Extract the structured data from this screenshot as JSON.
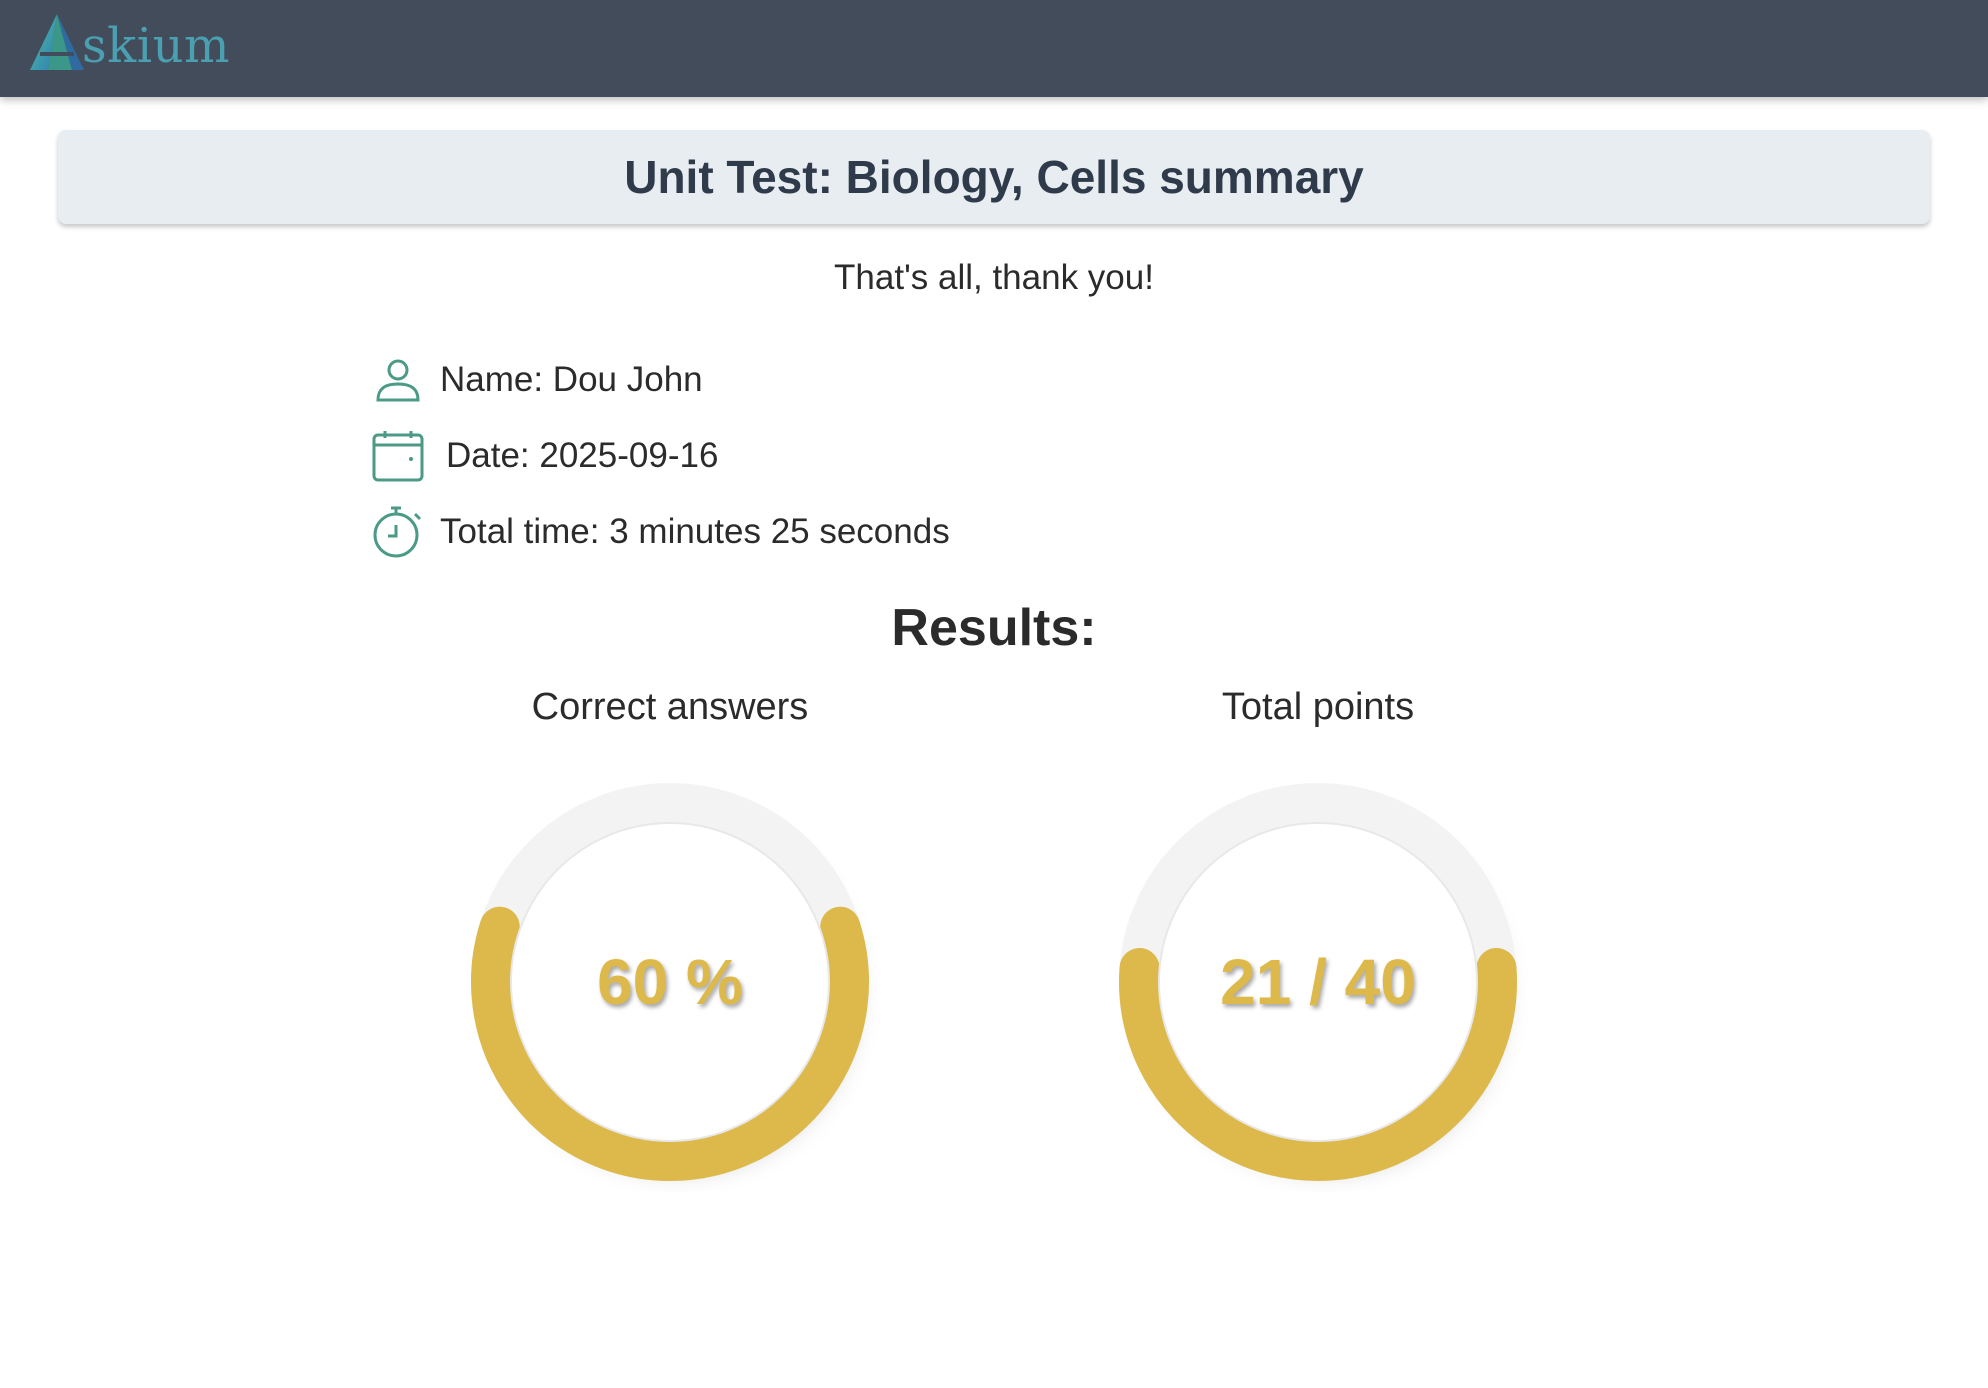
{
  "app": {
    "logo_text": "skium",
    "logo_icon": "triangle-a-logo"
  },
  "page": {
    "title": "Unit Test: Biology, Cells summary",
    "thanks": "That's all, thank you!"
  },
  "info": {
    "name": "Name: Dou John",
    "date": "Date: 2025-09-16",
    "total_time": "Total time: 3 minutes 25 seconds",
    "name_icon": "person-icon",
    "date_icon": "calendar-icon",
    "time_icon": "stopwatch-icon"
  },
  "results": {
    "title": "Results:",
    "correct_answers": {
      "label": "Correct answers",
      "value_text": "60 %",
      "fraction": 0.6
    },
    "total_points": {
      "label": "Total points",
      "value_text": "21 / 40",
      "fraction": 0.525
    }
  },
  "colors": {
    "header_bg": "#424c5a",
    "accent_green": "#4a9a86",
    "gauge_fill": "#dcb94a",
    "title_card_bg": "#e8edf1"
  }
}
